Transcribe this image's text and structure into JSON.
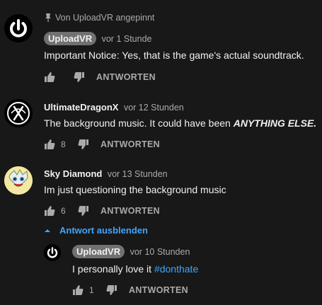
{
  "comments": [
    {
      "pinned_label": "Von UploadVR angepinnt",
      "author": "UploadVR",
      "time": "vor 1 Stunde",
      "text": "Important Notice: Yes, that is the game's actual soundtrack.",
      "likes": "",
      "reply_label": "ANTWORTEN"
    },
    {
      "author": "UltimateDragonX",
      "time": "vor 12 Stunden",
      "text_prefix": "The background music. It could have been ",
      "text_emphasis": "ANYTHING ELSE.",
      "likes": "8",
      "reply_label": "ANTWORTEN"
    },
    {
      "author": "Sky Diamond",
      "time": "vor 13 Stunden",
      "text": "Im just questioning the background music",
      "likes": "6",
      "reply_label": "ANTWORTEN",
      "hide_replies_label": "Antwort ausblenden"
    }
  ],
  "reply": {
    "author": "UploadVR",
    "time": "vor 10 Stunden",
    "text_prefix": "I personally love it ",
    "hashtag": "#donthate",
    "likes": "1",
    "reply_label": "ANTWORTEN"
  },
  "colors": {
    "background": "#181818",
    "link": "#3ea6ff",
    "secondary_text": "#aaaaaa",
    "badge": "#717171"
  }
}
